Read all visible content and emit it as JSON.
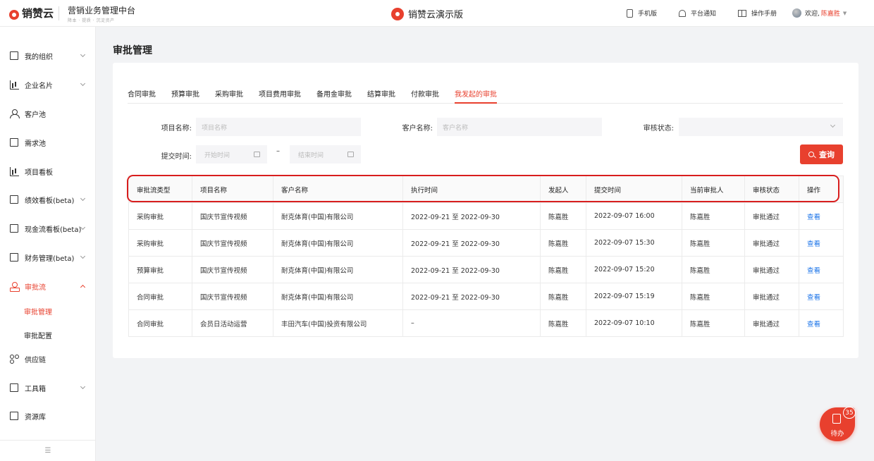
{
  "header": {
    "logo_text": "销赞云",
    "platform_title": "营销业务管理中台",
    "platform_subtitle": "降本 · 提质 · 沉淀资产",
    "demo_title": "销赞云演示版",
    "mobile": "手机版",
    "notifications": "平台通知",
    "manual": "操作手册",
    "welcome": "欢迎,",
    "user": "陈嘉胜"
  },
  "sidebar": {
    "items": [
      {
        "label": "我的组织",
        "icon": "org-icon"
      },
      {
        "label": "企业名片",
        "icon": "building-icon"
      },
      {
        "label": "客户池",
        "icon": "user-icon"
      },
      {
        "label": "需求池",
        "icon": "list-icon"
      },
      {
        "label": "项目看板",
        "icon": "board-icon"
      },
      {
        "label": "绩效看板(beta)",
        "icon": "chart-icon"
      },
      {
        "label": "现金流看板(beta)",
        "icon": "cash-icon"
      },
      {
        "label": "财务管理(beta)",
        "icon": "wallet-icon"
      },
      {
        "label": "审批流",
        "icon": "approval-icon"
      },
      {
        "label": "供应链",
        "icon": "supply-icon"
      },
      {
        "label": "工具箱",
        "icon": "toolbox-icon"
      },
      {
        "label": "资源库",
        "icon": "folder-icon"
      }
    ],
    "sub_items": [
      "审批管理",
      "审批配置"
    ],
    "collapse_glyph": "☰"
  },
  "page": {
    "title": "审批管理"
  },
  "tabs": [
    "合同审批",
    "预算审批",
    "采购审批",
    "项目费用审批",
    "备用金审批",
    "结算审批",
    "付款审批",
    "我发起的审批"
  ],
  "filters": {
    "project_label": "项目名称:",
    "project_placeholder": "项目名称",
    "customer_label": "客户名称:",
    "customer_placeholder": "客户名称",
    "status_label": "审核状态:",
    "submit_label": "提交时间:",
    "start_placeholder": "开始时间",
    "end_placeholder": "结束时间",
    "dash": "–",
    "query": "查询"
  },
  "table": {
    "columns": [
      "审批流类型",
      "项目名称",
      "客户名称",
      "执行时间",
      "发起人",
      "提交时间",
      "当前审批人",
      "审核状态",
      "操作"
    ],
    "rows": [
      [
        "采购审批",
        "国庆节宣传视频",
        "耐克体育(中国)有限公司",
        "2022-09-21 至 2022-09-30",
        "陈嘉胜",
        "2022-09-07 16:00",
        "陈嘉胜",
        "审批通过",
        "查看"
      ],
      [
        "采购审批",
        "国庆节宣传视频",
        "耐克体育(中国)有限公司",
        "2022-09-21 至 2022-09-30",
        "陈嘉胜",
        "2022-09-07 15:30",
        "陈嘉胜",
        "审批通过",
        "查看"
      ],
      [
        "预算审批",
        "国庆节宣传视频",
        "耐克体育(中国)有限公司",
        "2022-09-21 至 2022-09-30",
        "陈嘉胜",
        "2022-09-07 15:20",
        "陈嘉胜",
        "审批通过",
        "查看"
      ],
      [
        "合同审批",
        "国庆节宣传视频",
        "耐克体育(中国)有限公司",
        "2022-09-21 至 2022-09-30",
        "陈嘉胜",
        "2022-09-07 15:19",
        "陈嘉胜",
        "审批通过",
        "查看"
      ],
      [
        "合同审批",
        "会员日活动运营",
        "丰田汽车(中国)投资有限公司",
        "–",
        "陈嘉胜",
        "2022-09-07 10:10",
        "陈嘉胜",
        "审批通过",
        "查看"
      ]
    ]
  },
  "todo": {
    "label": "待办",
    "badge": "35"
  },
  "colors": {
    "accent": "#e8402e",
    "link": "#1a73e8",
    "highlight": "#d81e1e"
  }
}
